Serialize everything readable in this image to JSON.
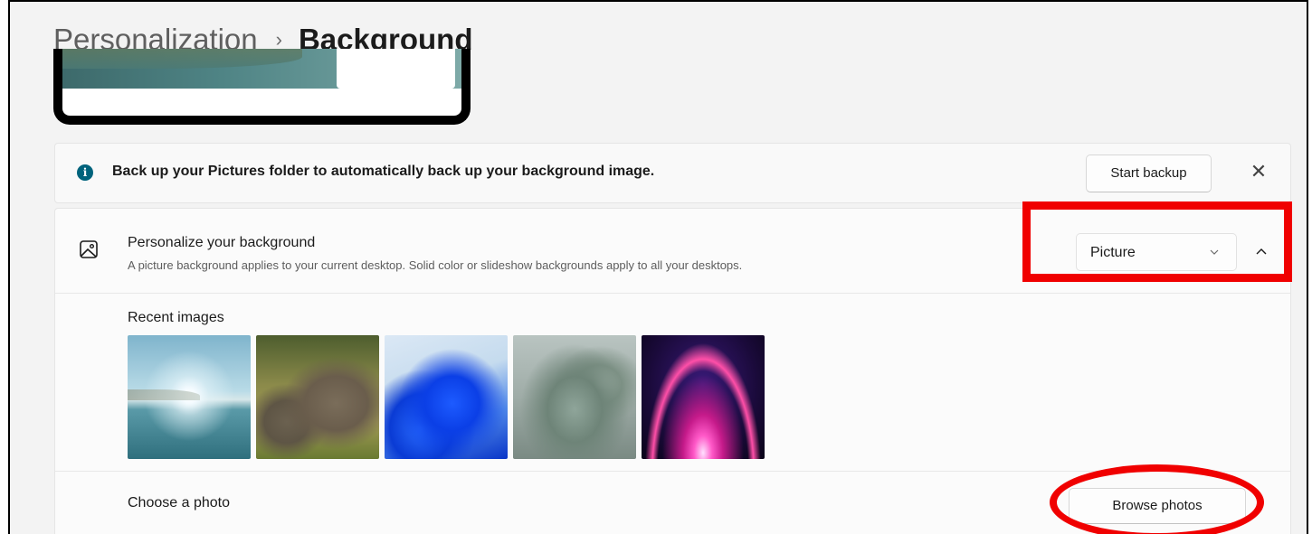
{
  "header": {
    "breadcrumb_parent": "Personalization",
    "breadcrumb_separator": "›",
    "page_title": "Background"
  },
  "info_bar": {
    "icon": "info-icon",
    "icon_glyph": "i",
    "message": "Back up your Pictures folder to automatically back up your background image.",
    "start_backup_label": "Start backup",
    "close_glyph": "✕"
  },
  "personalize": {
    "icon": "picture-icon",
    "title": "Personalize your background",
    "description": "A picture background applies to your current desktop. Solid color or slideshow backgrounds apply to all your desktops.",
    "dropdown_value": "Picture",
    "recent_images_label": "Recent images",
    "recent_images": [
      {
        "name": "lake-sunrise"
      },
      {
        "name": "rhinoceros"
      },
      {
        "name": "blue-bloom"
      },
      {
        "name": "gray-bloom"
      },
      {
        "name": "purple-glow"
      }
    ],
    "choose_photo_label": "Choose a photo",
    "browse_photos_label": "Browse photos"
  },
  "colors": {
    "highlight_red": "#f00000",
    "info_icon": "#00637c",
    "window_bg": "#f3f3f3"
  }
}
